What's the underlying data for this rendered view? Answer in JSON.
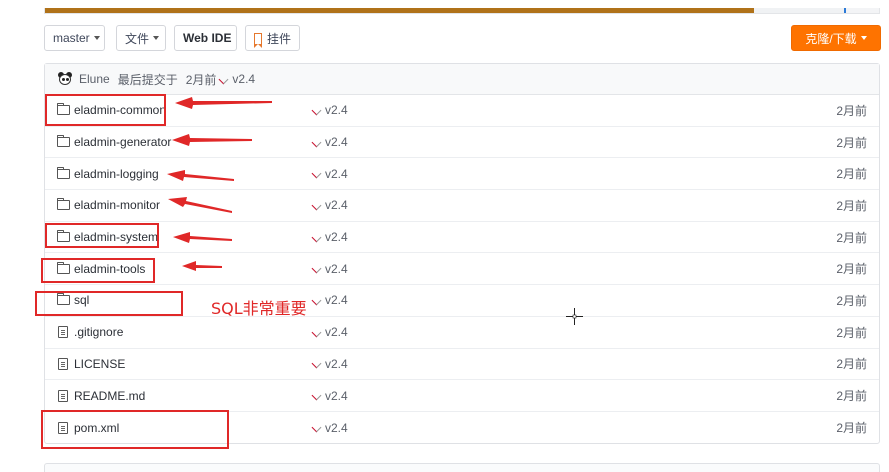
{
  "lang_bar": {
    "segments": [
      {
        "color": "#b07219",
        "fraction": 0.85
      },
      {
        "color": "#f0f2f4",
        "fraction": 0.108
      },
      {
        "color": "#2b7ad8",
        "fraction": 0.003
      },
      {
        "color": "#f3f4f6",
        "fraction": 0.039
      }
    ]
  },
  "toolbar": {
    "branch_label": "master",
    "files_label": "文件",
    "webide_label": "Web IDE",
    "widget_label": "挂件",
    "clone_label": "克隆/下载",
    "accent_color": "#fe7300"
  },
  "commit": {
    "author": "Elune",
    "text": "最后提交于",
    "time": "2月前",
    "tag": "v2.4"
  },
  "files": [
    {
      "icon": "folder-icon",
      "name": "eladmin-common",
      "msg": "v2.4",
      "time": "2月前"
    },
    {
      "icon": "folder-icon",
      "name": "eladmin-generator",
      "msg": "v2.4",
      "time": "2月前"
    },
    {
      "icon": "folder-icon",
      "name": "eladmin-logging",
      "msg": "v2.4",
      "time": "2月前"
    },
    {
      "icon": "folder-icon",
      "name": "eladmin-monitor",
      "msg": "v2.4",
      "time": "2月前"
    },
    {
      "icon": "folder-icon",
      "name": "eladmin-system",
      "msg": "v2.4",
      "time": "2月前"
    },
    {
      "icon": "folder-icon",
      "name": "eladmin-tools",
      "msg": "v2.4",
      "time": "2月前"
    },
    {
      "icon": "folder-icon",
      "name": "sql",
      "msg": "v2.4",
      "time": "2月前"
    },
    {
      "icon": "file-icon",
      "name": ".gitignore",
      "msg": "v2.4",
      "time": "2月前"
    },
    {
      "icon": "file-icon",
      "name": "LICENSE",
      "msg": "v2.4",
      "time": "2月前"
    },
    {
      "icon": "file-icon",
      "name": "README.md",
      "msg": "v2.4",
      "time": "2月前"
    },
    {
      "icon": "file-icon",
      "name": "pom.xml",
      "msg": "v2.4",
      "time": "2月前"
    }
  ],
  "annotation": {
    "note": "SQL非常重要",
    "color": "#e02828"
  }
}
